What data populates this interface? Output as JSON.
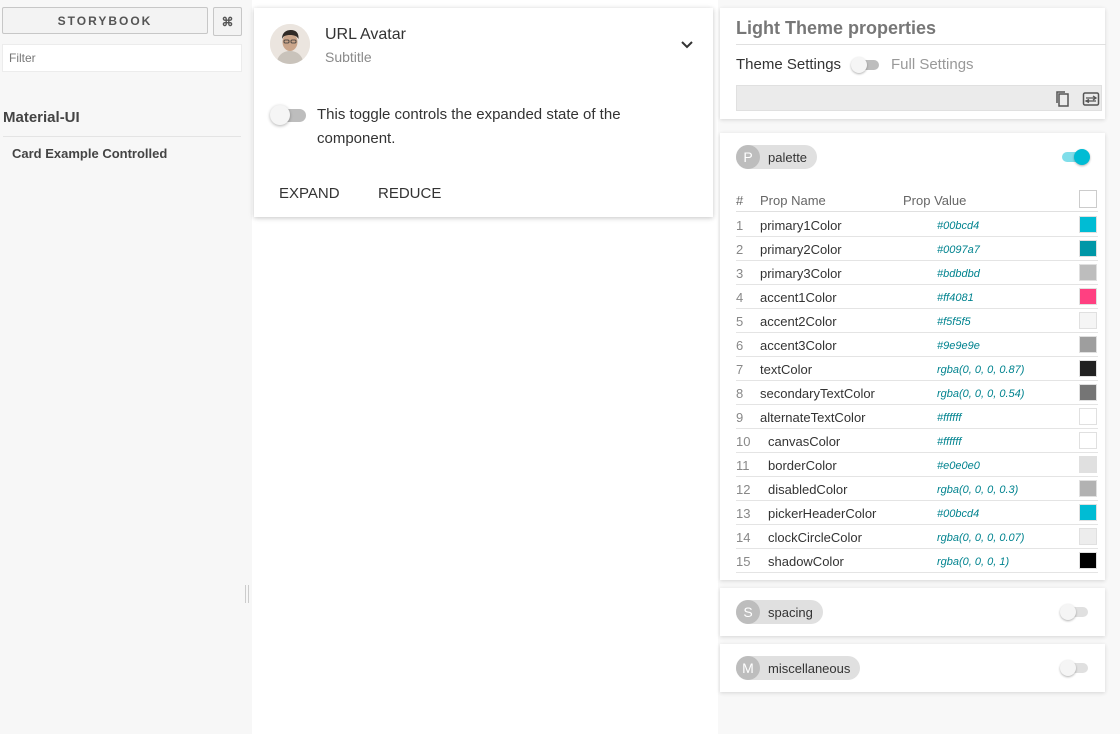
{
  "storybook": {
    "title": "STORYBOOK",
    "shortcut_label": "⌘",
    "filter_placeholder": "Filter",
    "kind": "Material-UI",
    "story": "Card Example Controlled"
  },
  "card": {
    "title": "URL Avatar",
    "subtitle": "Subtitle",
    "toggle_text": "This toggle controls the expanded state of the component.",
    "toggle_on": false,
    "expand_label": "EXPAND",
    "reduce_label": "REDUCE"
  },
  "theme": {
    "title": "Light Theme properties",
    "settings_label": "Theme Settings",
    "full_settings_label": "Full Settings",
    "settings_toggle_on": false
  },
  "palette": {
    "chip_letter": "P",
    "chip_label": "palette",
    "expanded": true,
    "headers": {
      "num": "#",
      "name": "Prop Name",
      "value": "Prop Value"
    },
    "rows": [
      {
        "num": "1",
        "name": "primary1Color",
        "value": "#00bcd4",
        "swatch": "#00bcd4"
      },
      {
        "num": "2",
        "name": "primary2Color",
        "value": "#0097a7",
        "swatch": "#0097a7"
      },
      {
        "num": "3",
        "name": "primary3Color",
        "value": "#bdbdbd",
        "swatch": "#bdbdbd"
      },
      {
        "num": "4",
        "name": "accent1Color",
        "value": "#ff4081",
        "swatch": "#ff4081"
      },
      {
        "num": "5",
        "name": "accent2Color",
        "value": "#f5f5f5",
        "swatch": "#f5f5f5"
      },
      {
        "num": "6",
        "name": "accent3Color",
        "value": "#9e9e9e",
        "swatch": "#9e9e9e"
      },
      {
        "num": "7",
        "name": "textColor",
        "value": "rgba(0, 0, 0, 0.87)",
        "swatch": "rgba(0,0,0,0.87)"
      },
      {
        "num": "8",
        "name": "secondaryTextColor",
        "value": "rgba(0, 0, 0, 0.54)",
        "swatch": "rgba(0,0,0,0.54)"
      },
      {
        "num": "9",
        "name": "alternateTextColor",
        "value": "#ffffff",
        "swatch": "#ffffff"
      },
      {
        "num": "10",
        "name": "canvasColor",
        "value": "#ffffff",
        "swatch": "#ffffff"
      },
      {
        "num": "11",
        "name": "borderColor",
        "value": "#e0e0e0",
        "swatch": "#e0e0e0"
      },
      {
        "num": "12",
        "name": "disabledColor",
        "value": "rgba(0, 0, 0, 0.3)",
        "swatch": "rgba(0,0,0,0.3)"
      },
      {
        "num": "13",
        "name": "pickerHeaderColor",
        "value": "#00bcd4",
        "swatch": "#00bcd4"
      },
      {
        "num": "14",
        "name": "clockCircleColor",
        "value": "rgba(0, 0, 0, 0.07)",
        "swatch": "rgba(0,0,0,0.07)"
      },
      {
        "num": "15",
        "name": "shadowColor",
        "value": "rgba(0, 0, 0, 1)",
        "swatch": "rgba(0,0,0,1)"
      }
    ]
  },
  "spacing": {
    "chip_letter": "S",
    "chip_label": "spacing",
    "expanded": false
  },
  "miscellaneous": {
    "chip_letter": "M",
    "chip_label": "miscellaneous",
    "expanded": false
  },
  "icons": {
    "chevron": "chevron-down-icon",
    "copy": "copy-icon",
    "swap": "swap-icon"
  }
}
